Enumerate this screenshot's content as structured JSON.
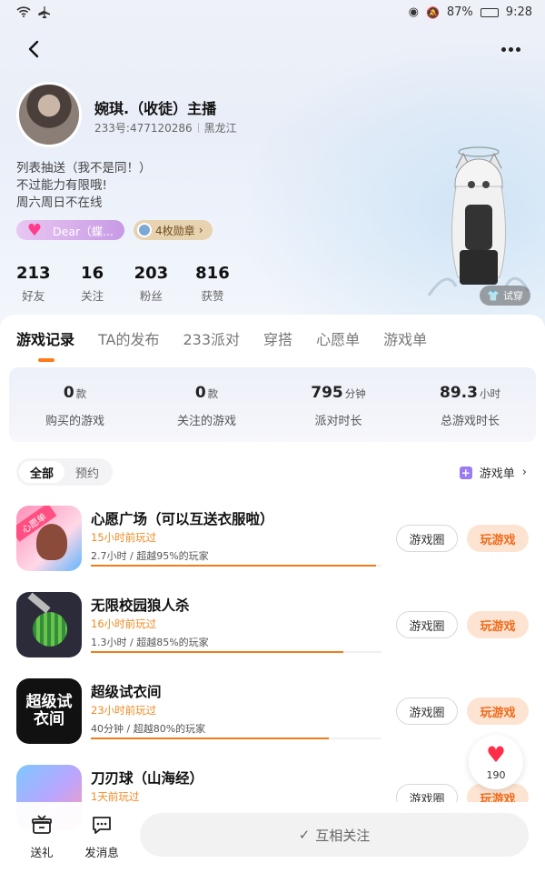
{
  "status_bar": {
    "battery": "87%",
    "time": "9:28"
  },
  "profile": {
    "nickname": "婉琪.（收徒）主播",
    "uid": "233号:477120286",
    "region": "黑龙江",
    "bio": [
      "列表抽送（我不是同！）",
      "不过能力有限哦!",
      "周六周日不在线"
    ],
    "badge_name": "Dear（蝶...",
    "medal_label": "4枚勋章",
    "stats": [
      {
        "value": "213",
        "label": "好友"
      },
      {
        "value": "16",
        "label": "关注"
      },
      {
        "value": "203",
        "label": "粉丝"
      },
      {
        "value": "816",
        "label": "获赞"
      }
    ],
    "try_on_label": "试穿"
  },
  "tabs": [
    "游戏记录",
    "TA的发布",
    "233派对",
    "穿搭",
    "心愿单",
    "游戏单"
  ],
  "active_tab": 0,
  "summary": [
    {
      "value": "0",
      "unit": "款",
      "label": "购买的游戏"
    },
    {
      "value": "0",
      "unit": "款",
      "label": "关注的游戏"
    },
    {
      "value": "795",
      "unit": "分钟",
      "label": "派对时长"
    },
    {
      "value": "89.3",
      "unit": "小时",
      "label": "总游戏时长"
    }
  ],
  "filter": {
    "all": "全部",
    "reserve": "预约"
  },
  "gamelist_link": "游戏单",
  "games": [
    {
      "name": "心愿广场（可以互送衣服啦）",
      "recent": "15小时前玩过",
      "stat": "2.7小时 / 超越95%的玩家",
      "progress": 0.98,
      "icon_text": "心愿单",
      "btn_circle": "游戏圈",
      "btn_play": "玩游戏"
    },
    {
      "name": "无限校园狼人杀",
      "recent": "16小时前玩过",
      "stat": "1.3小时 / 超越85%的玩家",
      "progress": 0.87,
      "icon_text": "",
      "btn_circle": "游戏圈",
      "btn_play": "玩游戏"
    },
    {
      "name": "超级试衣间",
      "recent": "23小时前玩过",
      "stat": "40分钟 / 超越80%的玩家",
      "progress": 0.82,
      "icon_text": "超级试衣间",
      "btn_circle": "游戏圈",
      "btn_play": "玩游戏"
    },
    {
      "name": "刀刃球（山海经）",
      "recent": "1天前玩过",
      "stat": "",
      "progress": 0,
      "icon_text": "",
      "btn_circle": "游戏圈",
      "btn_play": "玩游戏"
    }
  ],
  "like_float": {
    "count": "190"
  },
  "bottom_bar": {
    "gift": "送礼",
    "message": "发消息",
    "follow": "互相关注"
  },
  "colors": {
    "accent": "#f07d1a",
    "play_bg": "#fde4d2",
    "heart": "#ff2d4a"
  }
}
